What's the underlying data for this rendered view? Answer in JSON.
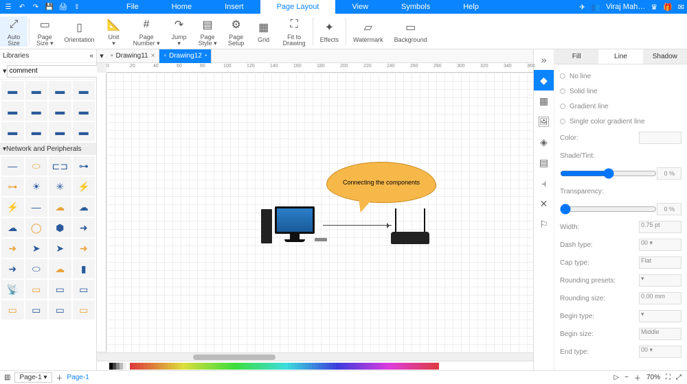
{
  "topmenu": {
    "items": [
      "File",
      "Home",
      "Insert",
      "Page Layout",
      "View",
      "Symbols",
      "Help"
    ],
    "active": 3
  },
  "user": {
    "name": "Viraj Mah…"
  },
  "ribbon": [
    {
      "label": "Auto\nSize",
      "icon": "⤢",
      "active": true
    },
    {
      "label": "Page\nSize ▾",
      "icon": "▭"
    },
    {
      "label": "Orientation",
      "icon": "▯"
    },
    {
      "label": "Unit\n▾",
      "icon": "📐"
    },
    {
      "label": "Page\nNumber ▾",
      "icon": "#"
    },
    {
      "label": "Jump\n▾",
      "icon": "↷"
    },
    {
      "label": "Page\nStyle ▾",
      "icon": "▤"
    },
    {
      "label": "Page\nSetup",
      "icon": "⚙"
    },
    {
      "label": "Grid",
      "icon": "▦"
    },
    {
      "label": "Fit to\nDrawing",
      "icon": "⛶"
    },
    {
      "label": "Effects",
      "icon": "✦"
    },
    {
      "label": "Watermark",
      "icon": "▱"
    },
    {
      "label": "Background",
      "icon": "▭"
    }
  ],
  "libraries": {
    "title": "Libraries",
    "search": "comment",
    "category": "Network and Peripherals"
  },
  "tabs": [
    {
      "name": "Drawing11",
      "active": false
    },
    {
      "name": "Drawing12",
      "active": true,
      "dirty": true
    }
  ],
  "canvas": {
    "callout": "Connecting the components"
  },
  "rightpanel": {
    "tabs": [
      "Fill",
      "Line",
      "Shadow"
    ],
    "active": 1,
    "options": [
      "No line",
      "Solid line",
      "Gradient line",
      "Single color gradient line"
    ],
    "labels": {
      "color": "Color:",
      "shade": "Shade/Tint:",
      "transparency": "Transparency:",
      "width": "Width:",
      "dash": "Dash type:",
      "cap": "Cap type:",
      "rounding": "Rounding presets:",
      "rsize": "Rounding size:",
      "begintype": "Begin type:",
      "beginsize": "Begin size:",
      "endtype": "End type:"
    },
    "values": {
      "pct": "0 %",
      "width": "0.75 pt",
      "dash": "00 ▾",
      "cap": "Flat",
      "rsize": "0.00 mm",
      "beginsize": "Middle",
      "endtype": "00 ▾"
    }
  },
  "status": {
    "page": "Page-1",
    "sheet": "Page-1",
    "zoom": "70%"
  }
}
